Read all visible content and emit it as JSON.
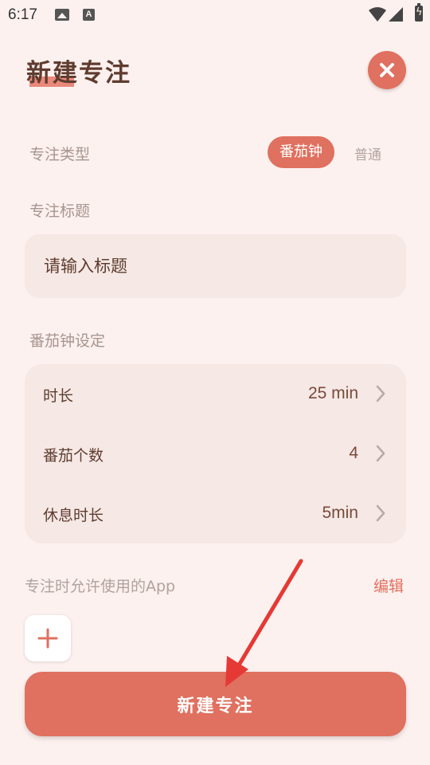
{
  "status_bar": {
    "time": "6:17",
    "icons": [
      "image-icon",
      "text-a-icon",
      "wifi-icon",
      "signal-icon",
      "battery-charging-icon"
    ],
    "a_glyph": "A"
  },
  "header": {
    "title": "新建专注",
    "close_icon": "close-icon"
  },
  "focus_type": {
    "label": "专注类型",
    "options": [
      "番茄钟",
      "普通"
    ],
    "selected": "番茄钟"
  },
  "focus_title": {
    "label": "专注标题",
    "placeholder": "请输入标题",
    "value": ""
  },
  "pomodoro": {
    "label": "番茄钟设定",
    "rows": [
      {
        "label": "时长",
        "value": "25 min"
      },
      {
        "label": "番茄个数",
        "value": "4"
      },
      {
        "label": "休息时长",
        "value": "5min"
      }
    ]
  },
  "allowed_apps": {
    "label": "专注时允许使用的App",
    "edit_label": "编辑",
    "add_icon": "plus-icon"
  },
  "create_button": {
    "label": "新建专注"
  },
  "colors": {
    "background": "#fdf1ef",
    "accent": "#e0705f",
    "card": "#f5e8e5",
    "title_text": "#5f3c2f",
    "annotation_arrow": "#e53935"
  }
}
